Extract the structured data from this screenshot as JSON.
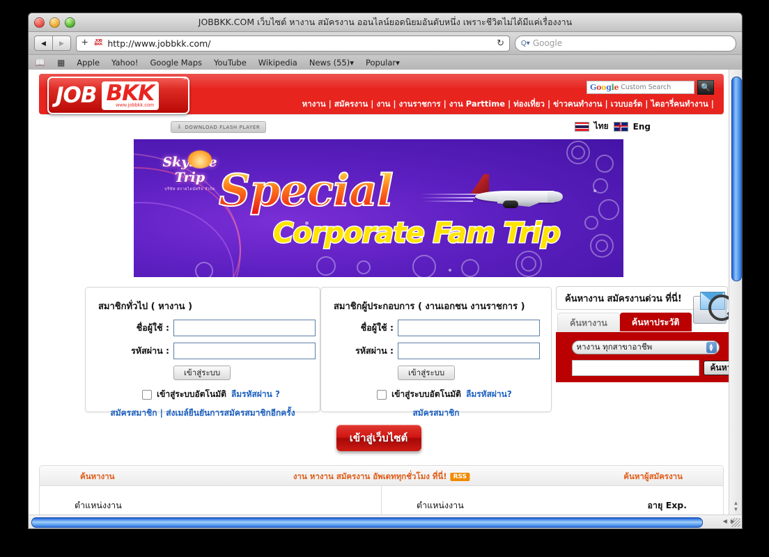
{
  "browser": {
    "window_title": "JOBBKK.COM เว็บไซต์ หางาน สมัครงาน ออนไลน์ยอดนิยมอันดับหนึ่ง เพราะชีวิตไม่ได้มีแค่เรื่องงาน",
    "back_glyph": "◀",
    "forward_glyph": "▶",
    "add_tab_glyph": "+",
    "favicon_line1": "JOB",
    "favicon_line2": "BKK",
    "address_value": "http://www.jobbkk.com/",
    "reload_glyph": "↻",
    "search_placeholder": "Google",
    "search_icon": "Q▾",
    "bookmarks": [
      {
        "icon": "book-icon",
        "label": "📖"
      },
      {
        "icon": "grid-icon",
        "label": "▦"
      },
      {
        "icon": "",
        "label": "Apple"
      },
      {
        "icon": "",
        "label": "Yahoo!"
      },
      {
        "icon": "",
        "label": "Google Maps"
      },
      {
        "icon": "",
        "label": "YouTube"
      },
      {
        "icon": "",
        "label": "Wikipedia"
      },
      {
        "icon": "",
        "label": "News (55)▾"
      },
      {
        "icon": "",
        "label": "Popular▾"
      }
    ]
  },
  "site": {
    "logo": {
      "job": "JOB",
      "bkk": "BKK",
      "url": "www.jobbkk.com",
      "tm": "™"
    },
    "nav": "หางาน | สมัครงาน | งาน | งานราชการ | งาน Parttime | ท่องเที่ยว | ข่าวคนทำงาน | เวบบอร์ด | ไดอารี่คนทำงาน |",
    "google_search": {
      "g1": "G",
      "g2": "o",
      "g3": "o",
      "g4": "g",
      "g5": "l",
      "g6": "e",
      "tm": "™",
      "label": "Custom Search",
      "button_icon": "🔍"
    },
    "flash_button": {
      "label": "DOWNLOAD FLASH PLAYER",
      "icon": "⬇"
    },
    "languages": [
      {
        "flag": "thailand-flag",
        "label": "ไทย"
      },
      {
        "flag": "uk-flag",
        "label": "Eng"
      }
    ]
  },
  "banner": {
    "brand_line1": "Skyline Trip",
    "brand_line2": "บริษัท สกายไลน์ทริป จำกัด",
    "headline": "Special",
    "subheadline": "Corporate Fam Trip"
  },
  "login_general": {
    "title": "สมาชิกทั่วไป ( หางาน )",
    "username_label": "ชื่อผู้ใช้ :",
    "password_label": "รหัสผ่าน :",
    "username_value": "",
    "password_value": "",
    "submit_label": "เข้าสู่ระบบ",
    "remember_label": "เข้าสู่ระบบอัตโนมัติ",
    "forgot_label": "ลืมรหัสผ่าน ?",
    "bottom_links": "สมัครสมาชิก | ส่งเมล์ยืนยันการสมัครสมาชิกอีกครั้ง"
  },
  "login_employer": {
    "title": "สมาชิกผู้ประกอบการ ( งานเอกชน งานราชการ )",
    "username_label": "ชื่อผู้ใช้ :",
    "password_label": "รหัสผ่าน :",
    "username_value": "",
    "password_value": "",
    "submit_label": "เข้าสู่ระบบ",
    "remember_label": "เข้าสู่ระบบอัตโนมัติ",
    "forgot_label": "ลืมรหัสผ่าน?",
    "bottom_links": "สมัครสมาชิก"
  },
  "search_widget": {
    "headline": "ค้นหางาน สมัครงานด่วน ที่นี่!",
    "icon": "folder-envelope-magnifier-icon",
    "tabs": [
      {
        "label": "ค้นหางาน",
        "active": false
      },
      {
        "label": "ค้นหาประวัติ",
        "active": true
      }
    ],
    "select_value": "หางาน ทุกสาขาอาชีพ",
    "input_value": "",
    "button_label": "ค้นหา"
  },
  "enter_site": {
    "label": "เข้าสู่เว็บไซต์"
  },
  "job_board": {
    "header_left": "ค้นหางาน",
    "header_center": "งาน หางาน สมัครงาน อัพเดททุกชั่วโมง ที่นี่!",
    "rss_label": "RSS",
    "header_right": "ค้นหาผู้สมัครงาน",
    "col_left_position": "ตำแหน่งงาน",
    "col_right_position": "ตำแหน่งงาน",
    "col_right_age": "อายุ",
    "col_right_exp": "Exp."
  },
  "scrollbars": {
    "v_up": "▲",
    "v_down": "▼",
    "h_left": "◀",
    "h_right": "▶"
  },
  "colors": {
    "brand_red": "#e8241f",
    "panel_red": "#ba0000",
    "link_blue": "#1c5fc0",
    "orange": "#e05b17"
  }
}
